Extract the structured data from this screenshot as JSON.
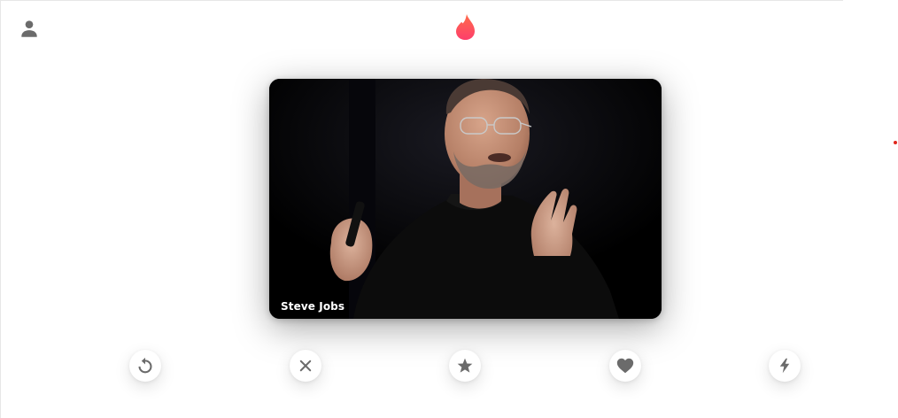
{
  "header": {
    "profile_icon": "person-icon",
    "logo_icon": "flame-icon",
    "logo_color": "#fd5068"
  },
  "card": {
    "name": "Steve Jobs",
    "photo": "presenter-photo"
  },
  "actions": [
    {
      "id": "rewind",
      "icon": "rewind-icon"
    },
    {
      "id": "nope",
      "icon": "close-icon"
    },
    {
      "id": "super_like",
      "icon": "star-icon"
    },
    {
      "id": "like",
      "icon": "heart-icon"
    },
    {
      "id": "boost",
      "icon": "lightning-icon"
    }
  ],
  "colors": {
    "icon_gray": "#6b6b6b",
    "indicator_dot": "#e0261c"
  }
}
